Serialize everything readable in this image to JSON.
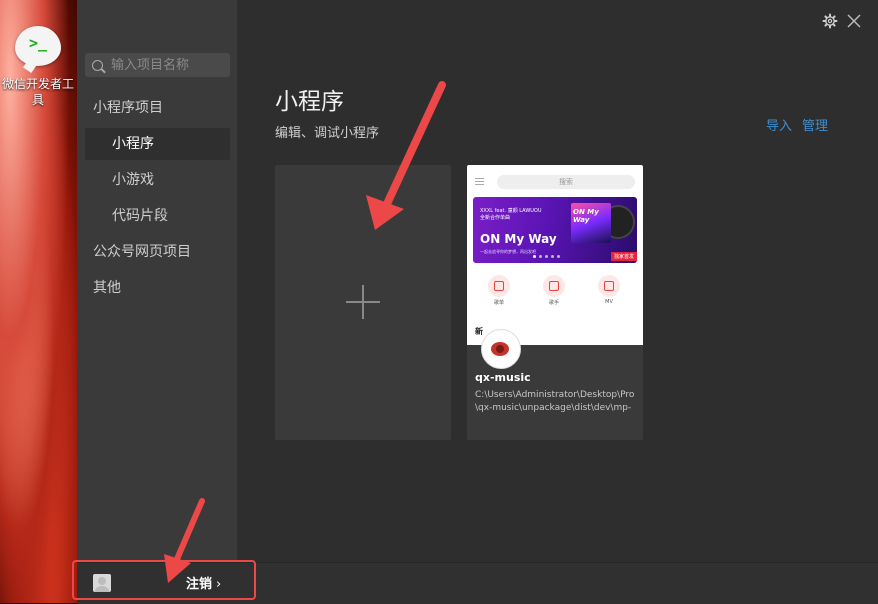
{
  "desktop": {
    "icon_glyph": ">_",
    "icon_label": "微信开发者工具"
  },
  "sidebar": {
    "search_placeholder": "输入项目名称",
    "items": [
      {
        "label": "小程序项目",
        "level": 0,
        "active": false
      },
      {
        "label": "小程序",
        "level": 1,
        "active": true
      },
      {
        "label": "小游戏",
        "level": 1,
        "active": false
      },
      {
        "label": "代码片段",
        "level": 1,
        "active": false
      },
      {
        "label": "公众号网页项目",
        "level": 0,
        "active": false
      },
      {
        "label": "其他",
        "level": 0,
        "active": false
      }
    ]
  },
  "header": {
    "title": "小程序",
    "subtitle": "编辑、调试小程序",
    "import_label": "导入",
    "manage_label": "管理"
  },
  "project": {
    "name": "qx-music",
    "path": "C:\\Users\\Administrator\\Desktop\\Pro\\qx-music\\unpackage\\dist\\dev\\mp-",
    "thumbnail": {
      "search_text": "搜索",
      "banner_line1": "XXXL feat. 童颜 LAWUOU",
      "banner_line2": "全新合作单曲",
      "banner_title": "ON My Way",
      "banner_line3": "一起去追寻你的梦想，再出发吧",
      "cover_text": "ON My Way",
      "tag_text": "独家首发",
      "features": [
        "歌单",
        "歌手",
        "MV"
      ],
      "section_title": "新"
    }
  },
  "bottom": {
    "logout_label": "注销",
    "chevron": "›"
  },
  "colors": {
    "accent_link": "#3f8fd1",
    "annotation_red": "#ec4848"
  }
}
